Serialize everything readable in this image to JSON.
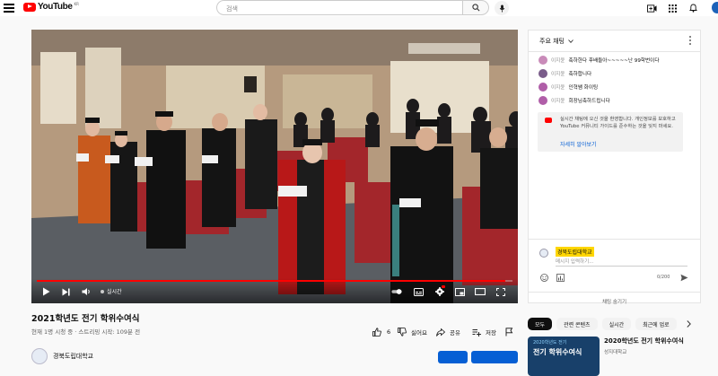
{
  "header": {
    "logo_text": "YouTube",
    "logo_country": "KR",
    "search_placeholder": "검색"
  },
  "player": {
    "live_label": "실시간",
    "progress_fraction": 0.985
  },
  "video": {
    "title": "2021학년도 전기 학위수여식",
    "meta": "현재 1명 시청 중 · 스트리밍 시작: 109분 전",
    "like_count": "6",
    "dislike_label": "싫어요",
    "share_label": "공유",
    "save_label": "저장",
    "channel_name": "경북도립대학교"
  },
  "chat": {
    "header_title": "주요 채팅",
    "messages": [
      {
        "author": "이지윤",
        "text": "축하한다 후배들아~~~~~난 99학번이다",
        "avatar_color": "#c98bb9"
      },
      {
        "author": "이지윤",
        "text": "축하합니다",
        "avatar_color": "#7a5c8a"
      },
      {
        "author": "이지윤",
        "text": "인혁쌤 화이팅",
        "avatar_color": "#b05ea8"
      },
      {
        "author": "이지윤",
        "text": "회장님축하드립니다",
        "avatar_color": "#b05ea8"
      }
    ],
    "notice_text": "실시간 채팅에 오신 것을 환영합니다. 개인정보를 보호하고 YouTube 커뮤니티 가이드를 준수하는 것을 잊지 마세요.",
    "notice_link": "자세히 알아보기",
    "composer_name": "경북도립대학교",
    "composer_placeholder": "메시지 입력하기...",
    "char_count": "0/200",
    "hide_label": "채팅 숨기기"
  },
  "chips": [
    "모두",
    "관련 콘텐츠",
    "실시간",
    "최근에 업로"
  ],
  "recommendation": {
    "thumb_small": "2020학년도 전기",
    "thumb_big": "전기 학위수여식",
    "title": "2020학년도 전기 학위수여식",
    "channel": "성지대학교"
  }
}
